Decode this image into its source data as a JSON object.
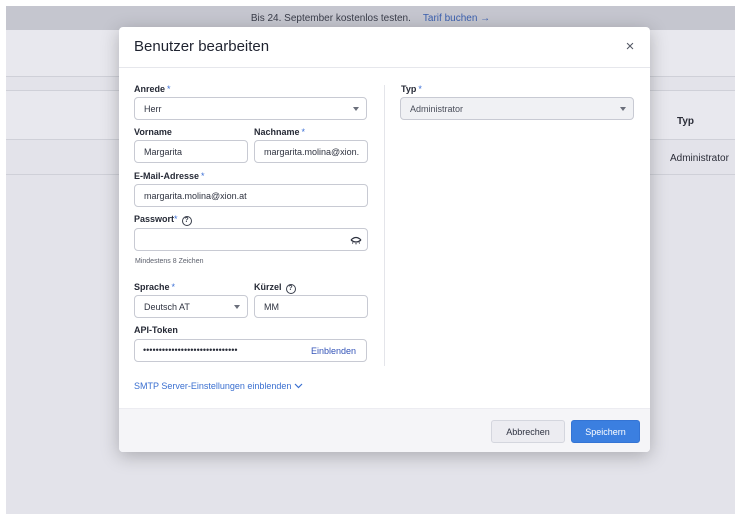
{
  "trial_banner": {
    "text": "Bis 24. September kostenlos testen.",
    "link": "Tarif buchen →"
  },
  "background_table": {
    "column_typ": "Typ",
    "row_typ_value": "Administrator"
  },
  "modal": {
    "title": "Benutzer bearbeiten",
    "close_icon": "×",
    "fields": {
      "anrede": {
        "label": "Anrede",
        "required": "*",
        "value": "Herr"
      },
      "vorname": {
        "label": "Vorname",
        "value": "Margarita"
      },
      "nachname": {
        "label": "Nachname",
        "required": "*",
        "value": "margarita.molina@xion."
      },
      "email": {
        "label": "E-Mail-Adresse",
        "required": "*",
        "value": "margarita.molina@xion.at"
      },
      "passwort": {
        "label": "Passwort",
        "required": "*",
        "help": "?",
        "value": "",
        "hint": "Mindestens 8 Zeichen"
      },
      "sprache": {
        "label": "Sprache",
        "required": "*",
        "value": "Deutsch AT"
      },
      "kuerzel": {
        "label": "Kürzel",
        "help": "?",
        "value": "MM"
      },
      "api_token": {
        "label": "API-Token",
        "masked": "••••••••••••••••••••••••••••••",
        "show_label": "Einblenden"
      },
      "typ": {
        "label": "Typ",
        "required": "*",
        "value": "Administrator"
      }
    },
    "smtp_link": "SMTP Server-Einstellungen einblenden",
    "buttons": {
      "cancel": "Abbrechen",
      "save": "Speichern"
    }
  },
  "colors": {
    "accent": "#3b7fe0",
    "link": "#3a6fd0",
    "required_marker": "#3b6fd6"
  }
}
